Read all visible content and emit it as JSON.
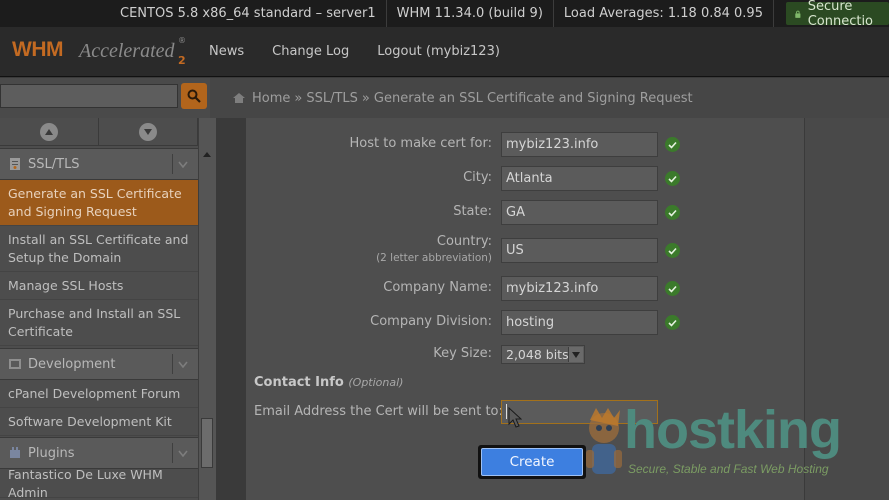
{
  "topbar": {
    "server": "CENTOS 5.8 x86_64 standard – server1",
    "version": "WHM 11.34.0 (build 9)",
    "load": "Load Averages: 1.18 0.84 0.95",
    "secure": "Secure Connectio"
  },
  "nav": {
    "logo_main": "WHM",
    "logo_accel": "Accelerated",
    "logo_num": "2",
    "logo_reg": "®",
    "links": [
      "News",
      "Change Log",
      "Logout (mybiz123)"
    ]
  },
  "breadcrumb": {
    "home": "Home",
    "sep1": "»",
    "section": "SSL/TLS",
    "sep2": "»",
    "page": "Generate an SSL Certificate and Signing Request"
  },
  "sidebar": {
    "ssl_header": "SSL/TLS",
    "ssl_items": [
      "Generate an SSL Certificate and Signing Request",
      "Install an SSL Certificate and Setup the Domain",
      "Manage SSL Hosts",
      "Purchase and Install an SSL Certificate"
    ],
    "dev_header": "Development",
    "dev_items": [
      "cPanel Development Forum",
      "Software Development Kit"
    ],
    "plugins_header": "Plugins",
    "plugin_items": [
      "Fantastico De Luxe WHM Admin"
    ]
  },
  "form": {
    "host_label": "Host to make cert for:",
    "host_value": "mybiz123.info",
    "city_label": "City:",
    "city_value": "Atlanta",
    "state_label": "State:",
    "state_value": "GA",
    "country_label": "Country:",
    "country_sub": "(2 letter abbreviation)",
    "country_value": "US",
    "company_label": "Company Name:",
    "company_value": "mybiz123.info",
    "division_label": "Company Division:",
    "division_value": "hosting",
    "keysize_label": "Key Size:",
    "keysize_value": "2,048 bits",
    "contact_title": "Contact Info",
    "contact_optional": "(Optional)",
    "email_label": "Email Address the Cert will be sent to:",
    "email_value": "",
    "create_label": "Create"
  },
  "watermark": {
    "brand": "hostking",
    "tagline": "Secure, Stable and Fast Web Hosting"
  },
  "colors": {
    "accent": "#b2651c",
    "check": "#3b7a2b",
    "button": "#3d7fe0"
  }
}
